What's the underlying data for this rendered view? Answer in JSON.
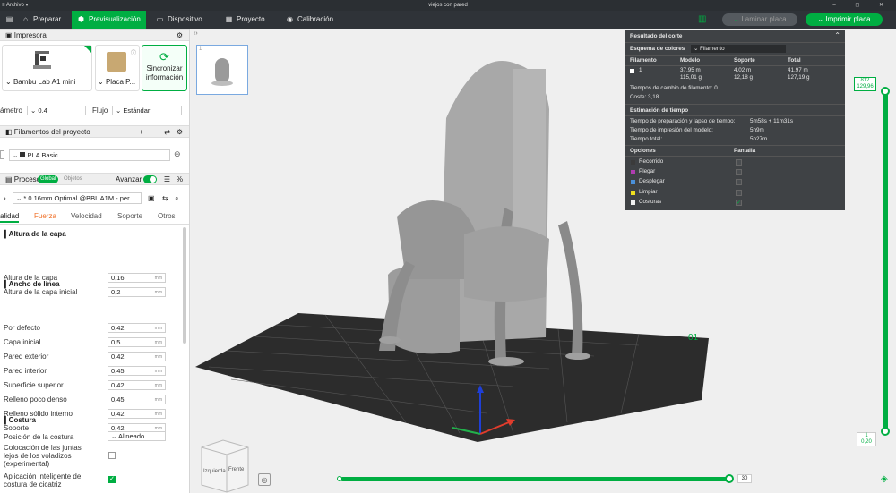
{
  "titlebar": {
    "menu": "Archivo",
    "title": "viejos con pared"
  },
  "tabs": [
    {
      "label": "Preparar",
      "icon": "home-icon"
    },
    {
      "label": "Previsualización",
      "icon": "cube-icon"
    },
    {
      "label": "Dispositivo",
      "icon": "monitor-icon"
    },
    {
      "label": "Proyecto",
      "icon": "document-icon"
    },
    {
      "label": "Calibración",
      "icon": "target-icon"
    }
  ],
  "toolbar": {
    "slice_label": "Laminar placa",
    "print_label": "Imprimir placa"
  },
  "printer": {
    "section_label": "Impresora",
    "printer_name": "Bambu Lab A1 mini",
    "plate_name": "Placa P...",
    "sync_label_1": "Sincronizar",
    "sync_label_2": "información",
    "nozzle_label": "ámetro",
    "nozzle_value": "0.4",
    "flow_label": "Flujo",
    "flow_value": "Estándar"
  },
  "filaments": {
    "section_label": "Filamentos del proyecto",
    "item": "PLA Basic"
  },
  "process": {
    "section_label": "Proceso",
    "toggle_global": "Global",
    "toggle_objects": "Objetos",
    "advanced_label": "Avanzar",
    "preset": "* 0.16mm Optimal @BBL A1M - per...",
    "tabs": [
      "alidad",
      "Fuerza",
      "Velocidad",
      "Soporte",
      "Otros"
    ]
  },
  "layer_height": {
    "heading": "Altura de la capa",
    "rows": [
      {
        "label": "Altura de la capa",
        "value": "0,16",
        "unit": "mm"
      },
      {
        "label": "Altura de la capa inicial",
        "value": "0,2",
        "unit": "mm"
      }
    ]
  },
  "line_width": {
    "heading": "Ancho de línea",
    "rows": [
      {
        "label": "Por defecto",
        "value": "0,42",
        "unit": "mm"
      },
      {
        "label": "Capa inicial",
        "value": "0,5",
        "unit": "mm"
      },
      {
        "label": "Pared exterior",
        "value": "0,42",
        "unit": "mm"
      },
      {
        "label": "Pared interior",
        "value": "0,45",
        "unit": "mm"
      },
      {
        "label": "Superficie superior",
        "value": "0,42",
        "unit": "mm"
      },
      {
        "label": "Relleno poco denso",
        "value": "0,45",
        "unit": "mm"
      },
      {
        "label": "Relleno sólido interno",
        "value": "0,42",
        "unit": "mm"
      },
      {
        "label": "Soporte",
        "value": "0,42",
        "unit": "mm"
      }
    ]
  },
  "seam": {
    "heading": "Costura",
    "position_label": "Posición de la costura",
    "position_value": "Alineado",
    "placement_label_1": "Colocación de las juntas",
    "placement_label_2": "lejos de los voladizos",
    "placement_label_3": "(experimental)",
    "smart_label_1": "Aplicación inteligente de",
    "smart_label_2": "costura de cicatriz"
  },
  "results": {
    "title": "Resultado del corte",
    "color_scheme_label": "Esquema de colores",
    "color_scheme_value": "Filamento",
    "cols": [
      "Filamento",
      "Modelo",
      "Soporte",
      "Total"
    ],
    "fil_id": "1",
    "model_m": "37,95 m",
    "model_g": "115,01 g",
    "support_m": "4,02 m",
    "support_g": "12,18 g",
    "total_m": "41,97 m",
    "total_g": "127,19 g",
    "changes": "Tiempos de cambio de filamento:  0",
    "cost": "Coste:  3,18",
    "time_heading": "Estimación de tiempo",
    "prep_label": "Tiempo de preparación y lapso de tiempo:",
    "prep_value": "5m58s + 11m31s",
    "print_label": "Tiempo de impresión del modelo:",
    "print_value": "5h9m",
    "total_label": "Tiempo total:",
    "total_value": "5h27m",
    "options_label": "Opciones",
    "display_label": "Pantalla",
    "options": [
      {
        "label": "Recorrido",
        "color": "#3b3b3b"
      },
      {
        "label": "Plegar",
        "color": "#b03cb0"
      },
      {
        "label": "Desplegar",
        "color": "#4a90d9"
      },
      {
        "label": "Limpiar",
        "color": "#f0e020"
      },
      {
        "label": "Costuras",
        "color": "#f0f0f0"
      }
    ]
  },
  "layer_slider": {
    "top_1": "812",
    "top_2": "129,96",
    "bottom_1": "1",
    "bottom_2": "0,20"
  },
  "move_slider": {
    "value": "30"
  },
  "view_cube": {
    "left": "Izquierda",
    "front": "Frente"
  },
  "plate_label": "01",
  "colors": {
    "accent": "#00ae42",
    "dark": "#2f3338"
  }
}
